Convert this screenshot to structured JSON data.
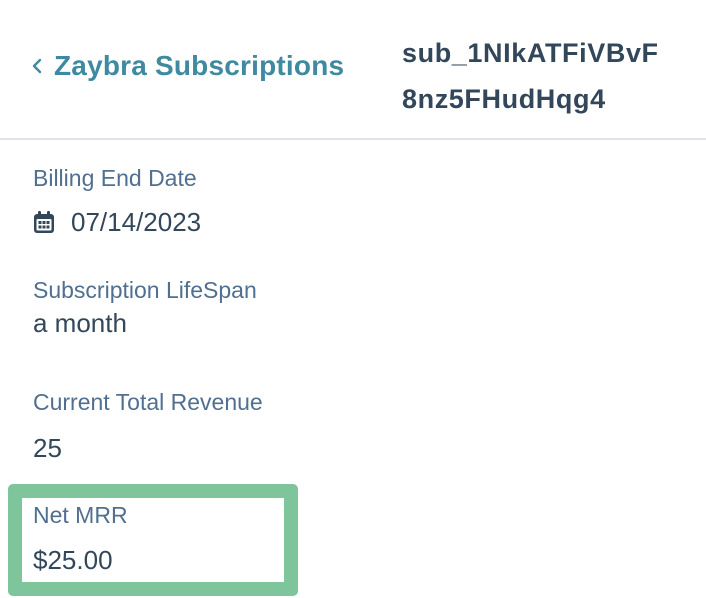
{
  "header": {
    "back_label": "Zaybra Subscriptions",
    "record_id_line1": "sub_1NIkATFiVBvF",
    "record_id_line2": "8nz5FHudHqg4"
  },
  "fields": {
    "billing_end_date": {
      "label": "Billing End Date",
      "value": "07/14/2023"
    },
    "subscription_lifespan": {
      "label": "Subscription LifeSpan",
      "value": "a month"
    },
    "current_total_revenue": {
      "label": "Current Total Revenue",
      "value": "25"
    },
    "net_mrr": {
      "label": "Net MRR",
      "value": "$25.00"
    }
  },
  "colors": {
    "link": "#3f8aa0",
    "label": "#516f90",
    "text": "#33475b",
    "highlight": "#7ec59b",
    "divider": "#dfe3eb"
  },
  "icons": {
    "back": "chevron-left-icon",
    "date": "calendar-icon"
  }
}
